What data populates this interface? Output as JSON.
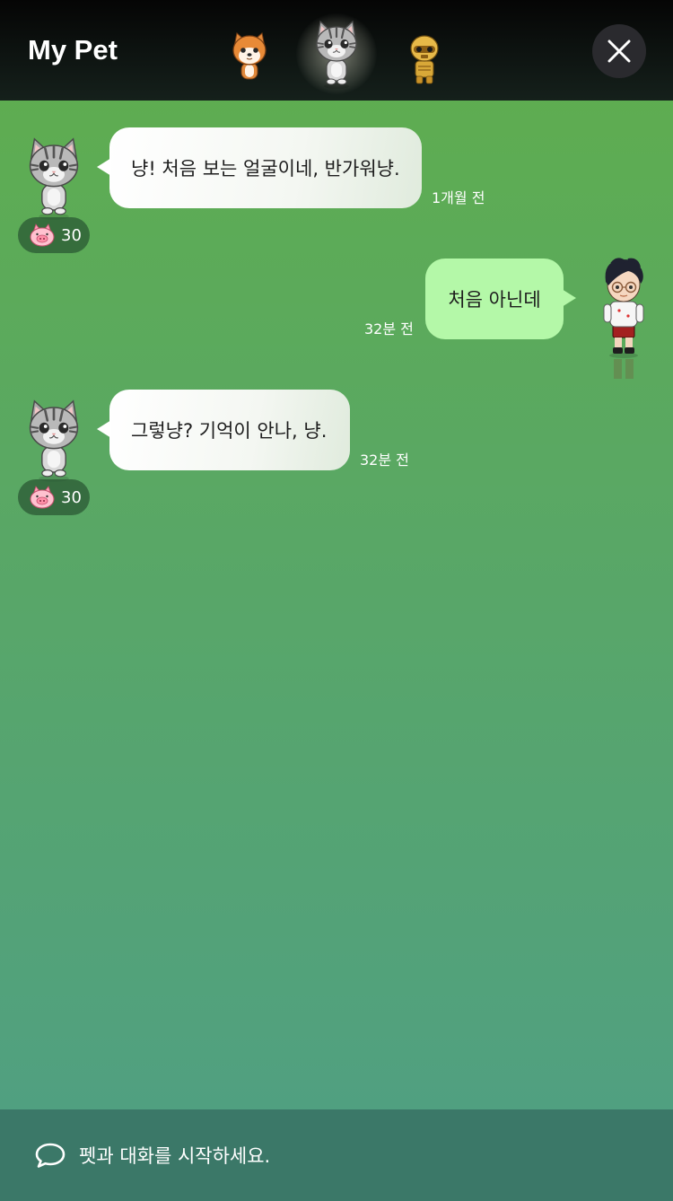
{
  "header": {
    "title": "My Pet",
    "pets": [
      {
        "icon": "shiba-dog-pet-icon"
      },
      {
        "icon": "tabby-cat-pet-icon",
        "selected": true
      },
      {
        "icon": "golden-robot-pet-icon"
      }
    ],
    "close_icon": "close-icon"
  },
  "messages": [
    {
      "sender": "pet",
      "avatar": "tabby-cat-avatar",
      "text": "냥! 처음 보는 얼굴이네, 반가워냥.",
      "time": "1개월 전",
      "points": "30"
    },
    {
      "sender": "user",
      "avatar": "user-character-avatar",
      "text": "처음 아닌데",
      "time": "32분 전"
    },
    {
      "sender": "pet",
      "avatar": "tabby-cat-avatar",
      "text": "그렇냥? 기억이 안나, 냥.",
      "time": "32분 전",
      "points": "30"
    }
  ],
  "footer": {
    "chat_icon": "chat-bubble-icon",
    "placeholder": "펫과 대화를 시작하세요."
  },
  "colors": {
    "header_bg": "#0b0f0d",
    "body_gradient_top": "#5fae4c",
    "body_gradient_bottom": "#4f9f85",
    "pet_bubble": "#ffffff",
    "user_bubble": "#b4f8a8",
    "footer_bg": "#3b7868",
    "close_button_bg": "#2a2a2e",
    "points_badge_bg": "#2d5a36"
  }
}
